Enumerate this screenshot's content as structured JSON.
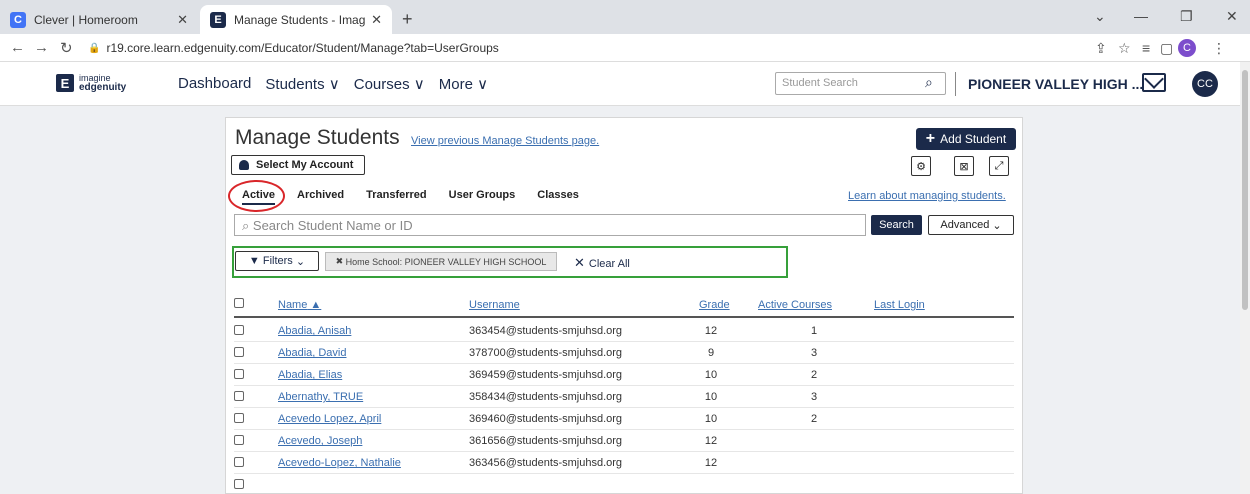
{
  "browser": {
    "tabs": [
      {
        "label": "Clever | Homeroom",
        "favicon": "C"
      },
      {
        "label": "Manage Students - Imagine Edg",
        "favicon": "E"
      }
    ],
    "url": "r19.core.learn.edgenuity.com/Educator/Student/Manage?tab=UserGroups",
    "profile_initial": "C"
  },
  "app": {
    "logo": {
      "line1": "imagine",
      "line2": "edgenuity",
      "mark": "E"
    },
    "nav": [
      "Dashboard",
      "Students ∨",
      "Courses ∨",
      "More ∨"
    ],
    "student_search_placeholder": "Student Search",
    "school_name": "PIONEER VALLEY HIGH ...",
    "user_initials": "CC"
  },
  "page": {
    "title": "Manage Students",
    "prev_link": "View previous Manage Students page.",
    "add_button": "Add Student",
    "select_account": "Select My Account",
    "tabs": [
      "Active",
      "Archived",
      "Transferred",
      "User Groups",
      "Classes"
    ],
    "learn_link": "Learn about managing students.",
    "search_placeholder": "Search Student Name or ID",
    "search_button": "Search",
    "advanced_button": "Advanced",
    "filters_button": "Filters",
    "filter_chip": "Home School: PIONEER VALLEY HIGH SCHOOL",
    "clear_all": "Clear All",
    "columns": {
      "name": "Name",
      "username": "Username",
      "grade": "Grade",
      "courses": "Active Courses",
      "login": "Last Login"
    },
    "rows": [
      {
        "name": "Abadia, Anisah",
        "username": "363454@students-smjuhsd.org",
        "grade": "12",
        "courses": "1"
      },
      {
        "name": "Abadia, David",
        "username": "378700@students-smjuhsd.org",
        "grade": "9",
        "courses": "3"
      },
      {
        "name": "Abadia, Elias",
        "username": "369459@students-smjuhsd.org",
        "grade": "10",
        "courses": "2"
      },
      {
        "name": "Abernathy, TRUE",
        "username": "358434@students-smjuhsd.org",
        "grade": "10",
        "courses": "3"
      },
      {
        "name": "Acevedo Lopez, April",
        "username": "369460@students-smjuhsd.org",
        "grade": "10",
        "courses": "2"
      },
      {
        "name": "Acevedo, Joseph",
        "username": "361656@students-smjuhsd.org",
        "grade": "12",
        "courses": ""
      },
      {
        "name": "Acevedo-Lopez, Nathalie",
        "username": "363456@students-smjuhsd.org",
        "grade": "12",
        "courses": ""
      }
    ]
  }
}
